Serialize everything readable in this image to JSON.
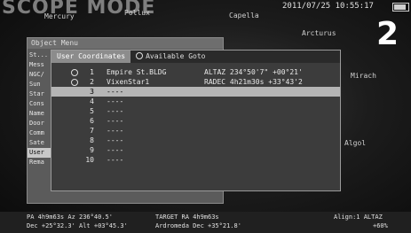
{
  "screen": {
    "title": "SCOPE MODE",
    "datetime": "2011/07/25 10:55:17",
    "step_number": "2"
  },
  "sky_labels": [
    {
      "text": "Mercury"
    },
    {
      "text": "Pollux"
    },
    {
      "text": "Capella"
    },
    {
      "text": "Arcturus"
    },
    {
      "text": "Mirach"
    },
    {
      "text": "Algol"
    }
  ],
  "object_menu": {
    "title": "Object Menu",
    "items": [
      "St...",
      "Mess",
      "NGC/",
      "Sun",
      "Star",
      "Cons",
      "Name",
      "Door",
      "Comm",
      "Sate",
      "User",
      "Rema"
    ]
  },
  "user_coordinates": {
    "tabs": [
      "User Coordinates",
      "Available Goto"
    ],
    "rows": [
      {
        "num": "1",
        "name": "Empire St.BLDG",
        "coord": "ALTAZ 234°50'7\" +00°21'"
      },
      {
        "num": "2",
        "name": "VixenStar1",
        "coord": "RADEC 4h21m30s +33°43'2"
      },
      {
        "num": "3",
        "name": "----",
        "coord": ""
      },
      {
        "num": "4",
        "name": "----",
        "coord": ""
      },
      {
        "num": "5",
        "name": "----",
        "coord": ""
      },
      {
        "num": "6",
        "name": "----",
        "coord": ""
      },
      {
        "num": "7",
        "name": "----",
        "coord": ""
      },
      {
        "num": "8",
        "name": "----",
        "coord": ""
      },
      {
        "num": "9",
        "name": "----",
        "coord": ""
      },
      {
        "num": "10",
        "name": "----",
        "coord": ""
      }
    ]
  },
  "status_bar": {
    "left": "PA 4h9m63s Az 236°40.5'",
    "left2": "Dec +25°32.3' Alt +03°45.3'",
    "middle": "TARGET RA 4h9m63s",
    "middle2": "Ardromeda Dec +35°21.8'",
    "right": "Align:1 ALTAZ",
    "right2": "+60%"
  }
}
